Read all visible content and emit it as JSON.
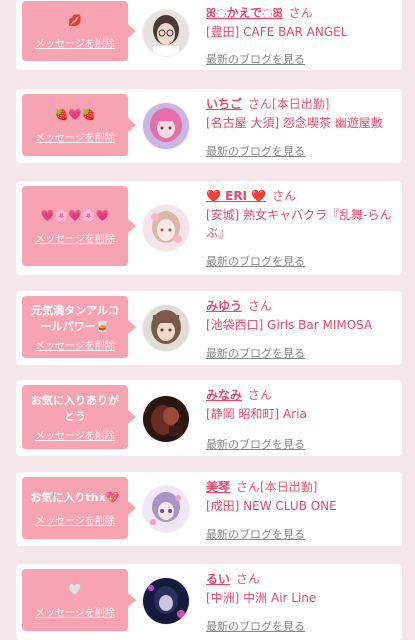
{
  "theme": {
    "accent": "#e24a70",
    "bubble": "#f7a3b2"
  },
  "delete_label": "メッセージを削除",
  "honorific": "さん",
  "blog_label": "最新のブログを見る",
  "cards": [
    {
      "message": "💋",
      "name": "ꕤ◌かえで◌ꕤ",
      "tag": "",
      "shop": "[豊田] CAFE BAR ANGEL",
      "avatar": "girl-glasses"
    },
    {
      "message": "🍓💗🍓",
      "name": "いちご",
      "tag": "[本日出勤]",
      "shop": "[名古屋 大須] 怨念喫茶 幽遊屋敷",
      "avatar": "pink-hair"
    },
    {
      "message": "💗🌸💗🌸💗",
      "name": "❤️ ERI ❤️",
      "tag": "",
      "shop": "[安城] 熟女キャバクラ『乱舞-らんぶ』",
      "avatar": "girl-light"
    },
    {
      "message": "元気満タンアルコールパワー🥃",
      "name": "みゆう",
      "tag": "",
      "shop": "[池袋西口] Girls Bar MIMOSA",
      "avatar": "girl-brown"
    },
    {
      "message": "お気に入りありがとう",
      "name": "みなみ",
      "tag": "",
      "shop": "[静岡 昭和町] Aria",
      "avatar": "dark-red"
    },
    {
      "message": "お気に入りthx💖",
      "name": "美琴",
      "tag": "[本日出勤]",
      "shop": "[成田] NEW CLUB ONE",
      "avatar": "anime-girl"
    },
    {
      "message": "🤍",
      "name": "るい",
      "tag": "",
      "shop": "[中洲] 中洲 Air Line",
      "avatar": "dark-blue"
    }
  ]
}
